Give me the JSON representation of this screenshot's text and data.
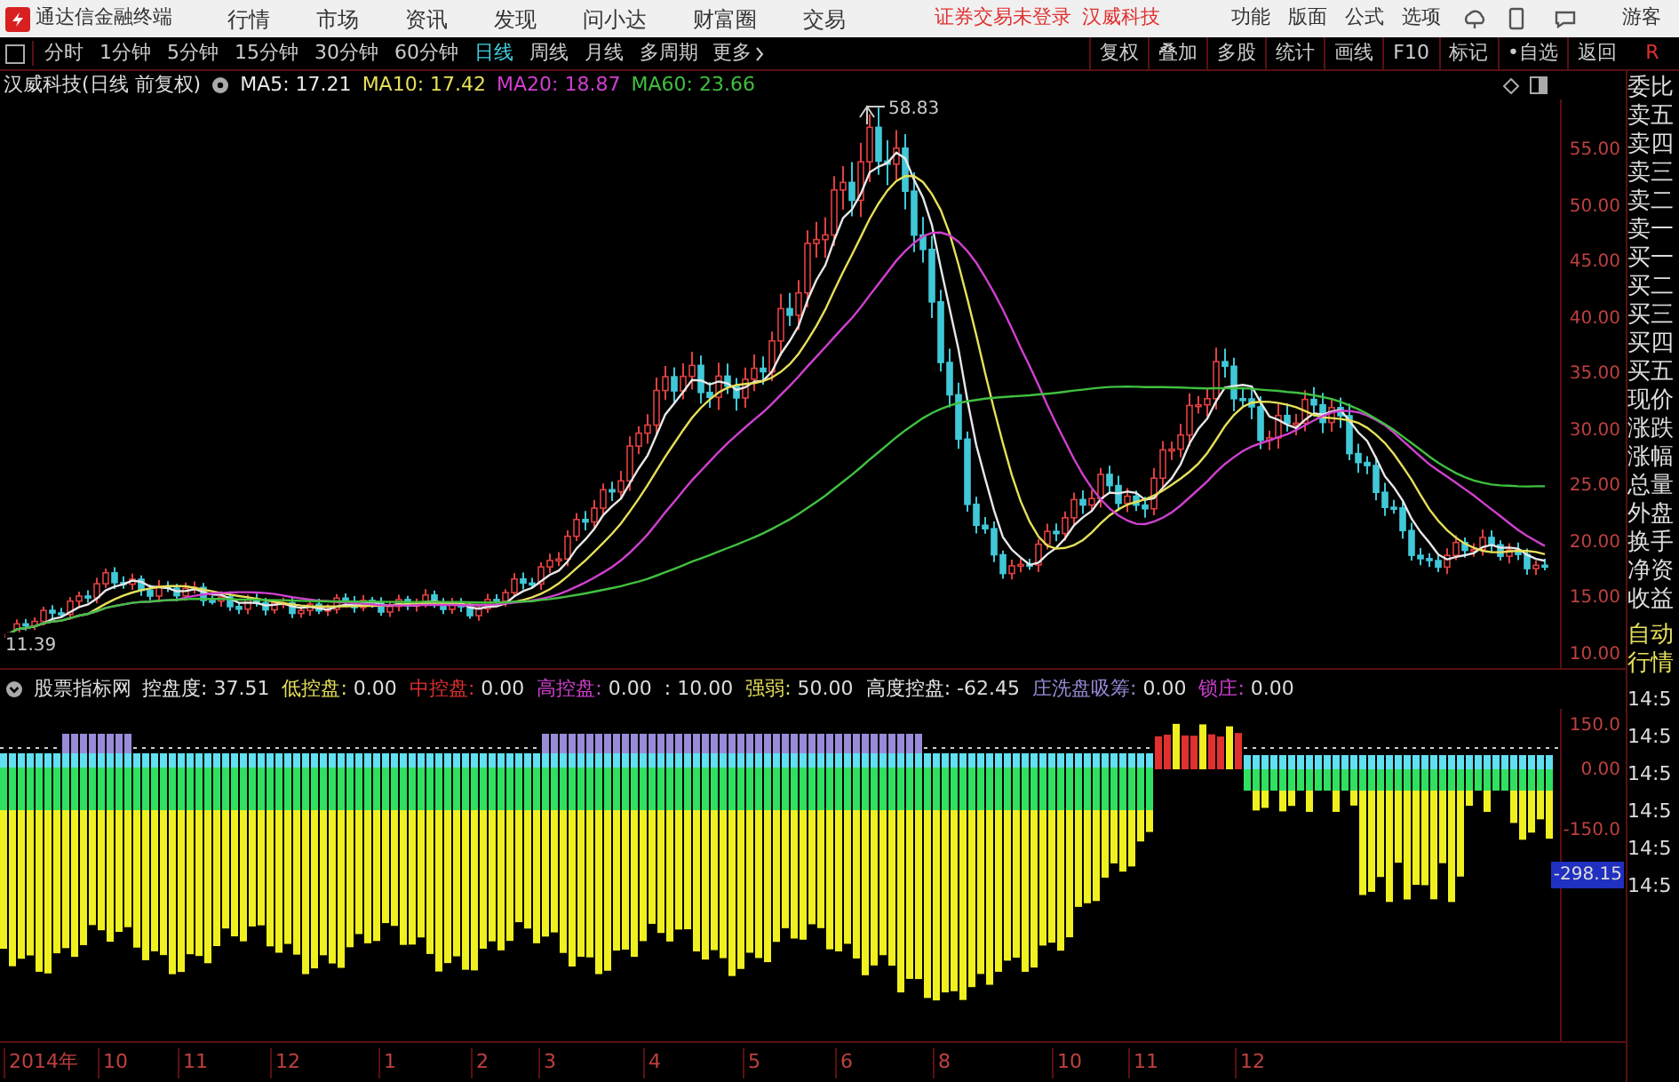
{
  "app": {
    "name": "通达信金融终端"
  },
  "menu": [
    "行情",
    "市场",
    "资讯",
    "发现",
    "问小达",
    "财富圈",
    "交易"
  ],
  "login_status": "证券交易未登录",
  "stock_name": "汉威科技",
  "right_menu": [
    "功能",
    "版面",
    "公式",
    "选项"
  ],
  "user": "游客",
  "period_tabs": [
    {
      "label": "分时",
      "selected": false
    },
    {
      "label": "1分钟",
      "selected": false
    },
    {
      "label": "5分钟",
      "selected": false
    },
    {
      "label": "15分钟",
      "selected": false
    },
    {
      "label": "30分钟",
      "selected": false
    },
    {
      "label": "60分钟",
      "selected": false
    },
    {
      "label": "日线",
      "selected": true
    },
    {
      "label": "周线",
      "selected": false
    },
    {
      "label": "月线",
      "selected": false
    },
    {
      "label": "多周期",
      "selected": false
    }
  ],
  "more": "更多",
  "toolbar_buttons": [
    "复权",
    "叠加",
    "多股",
    "统计",
    "画线",
    "F10",
    "标记",
    "•自选",
    "返回"
  ],
  "corner_mark": "R",
  "chart": {
    "title": "汉威科技(日线 前复权)",
    "ma": [
      {
        "label": "MA5: 17.21",
        "color": "#e8e8e8"
      },
      {
        "label": "MA10: 17.42",
        "color": "#e6e05a"
      },
      {
        "label": "MA20: 18.87",
        "color": "#d040d0"
      },
      {
        "label": "MA60: 23.66",
        "color": "#40c040"
      }
    ],
    "high_label": "58.83",
    "low_label": "11.39",
    "y_axis": [
      "55.00",
      "50.00",
      "45.00",
      "40.00",
      "35.00",
      "30.00",
      "25.00",
      "20.00",
      "15.00",
      "10.00"
    ]
  },
  "indicator": {
    "name": "股票指标网",
    "items": [
      {
        "label": "控盘度:",
        "value": "37.51",
        "color": "#e8e8e8"
      },
      {
        "label": "低控盘:",
        "value": "0.00",
        "color": "#e6e05a"
      },
      {
        "label": "中控盘:",
        "value": "0.00",
        "color": "#e03030"
      },
      {
        "label": "高控盘:",
        "value": "0.00",
        "color": "#d040d0"
      },
      {
        "label": ":",
        "value": "10.00",
        "color": "#e8e8e8"
      },
      {
        "label": "强弱:",
        "value": "50.00",
        "color": "#e6e05a"
      },
      {
        "label": "高度控盘:",
        "value": "-62.45",
        "color": "#e8e8e8"
      },
      {
        "label": "庄洗盘吸筹:",
        "value": "0.00",
        "color": "#9a8ad8"
      },
      {
        "label": "锁庄:",
        "value": "0.00",
        "color": "#d040d0"
      }
    ],
    "y_axis": [
      "150.0",
      "0.00",
      "-150.0"
    ],
    "current": "-298.15"
  },
  "side_panel": [
    "委比",
    "卖五",
    "卖四",
    "卖三",
    "卖二",
    "卖一",
    "买一",
    "买二",
    "买三",
    "买四",
    "买五",
    "现价",
    "涨跌",
    "涨幅",
    "总量",
    "外盘",
    "换手",
    "净资",
    "收益"
  ],
  "side_tabs": [
    "自动",
    "行情"
  ],
  "time_rows": [
    "14:5",
    "14:5",
    "14:5",
    "14:5",
    "14:5",
    "14:5"
  ],
  "x_axis": [
    "2014年",
    "10",
    "11",
    "12",
    "1",
    "2",
    "3",
    "4",
    "5",
    "6",
    "8",
    "10",
    "11",
    "12"
  ]
}
